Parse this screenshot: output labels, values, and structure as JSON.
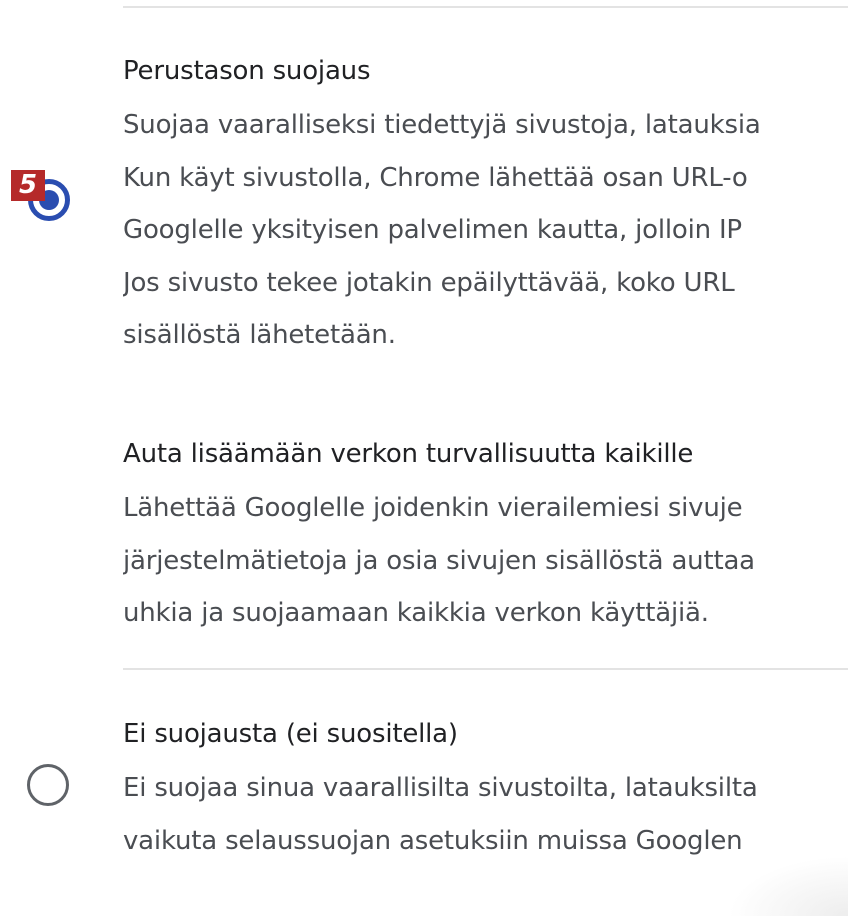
{
  "badge": "5",
  "options": [
    {
      "title": "Perustason suojaus",
      "lines": [
        "Suojaa vaaralliseksi tiedettyjä sivustoja, latauksia",
        "Kun käyt sivustolla, Chrome lähettää osan URL-o",
        "Googlelle yksityisen palvelimen kautta, jolloin IP",
        "Jos sivusto tekee jotakin epäilyttävää, koko URL",
        "sisällöstä lähetetään."
      ],
      "selected": true
    },
    {
      "title": "Auta lisäämään verkon turvallisuutta kaikille",
      "lines": [
        "Lähettää Googlelle joidenkin vierailemiesi sivuje",
        "järjestelmätietoja ja osia sivujen sisällöstä auttaa",
        "uhkia ja suojaamaan kaikkia verkon käyttäjiä."
      ]
    },
    {
      "title": "Ei suojausta (ei suositella)",
      "lines": [
        "Ei suojaa sinua vaarallisilta sivustoilta, latauksilta",
        "vaikuta selaussuojan asetuksiin muissa Googlen"
      ],
      "selected": false
    }
  ],
  "colors": {
    "accent": "#2a4db0",
    "badge": "#b52a2a",
    "divider": "#e3e3e3"
  }
}
